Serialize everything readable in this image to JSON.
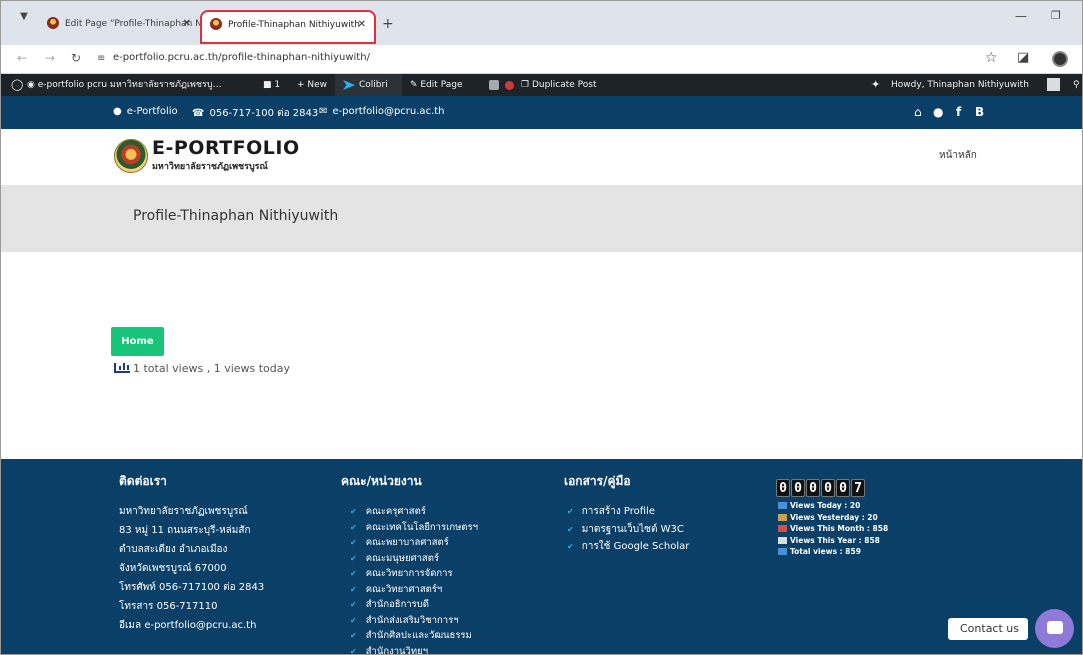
{
  "browser": {
    "tabs": [
      {
        "title": "Edit Page “Profile-Thinaphan N"
      },
      {
        "title": "Profile-Thinaphan Nithiyuwith"
      }
    ],
    "url": "e-portfolio.pcru.ac.th/profile-thinaphan-nithiyuwith/"
  },
  "adminbar": {
    "site": "e-portfolio pcru มหาวิทยาลัยราชภัฏเพชรบู…",
    "comments": "1",
    "new": "New",
    "colibri": "Colibri",
    "edit_page": "Edit Page",
    "duplicate": "Duplicate Post",
    "howdy": "Howdy, Thinaphan Nithiyuwith"
  },
  "topbar": {
    "portfolio": "e-Portfolio",
    "phone": "056-717-100 ต่อ 2843",
    "email": "e-portfolio@pcru.ac.th"
  },
  "header": {
    "logo_title": "E-PORTFOLIO",
    "logo_subtitle": "มหาวิทยาลัยราชภัฏเพชรบูรณ์",
    "nav_home": "หน้าหลัก"
  },
  "page": {
    "title": "Profile-Thinaphan Nithiyuwith",
    "home_button": "Home",
    "views": "1 total views , 1 views today"
  },
  "footer": {
    "contact": {
      "heading": "ติดต่อเรา",
      "lines": [
        "มหาวิทยาลัยราชภัฏเพชรบูรณ์",
        "83 หมู่ 11 ถนนสระบุรี-หล่มสัก",
        "ตำบลสะเดียง อำเภอเมือง",
        "จังหวัดเพชรบูรณ์ 67000",
        "โทรศัพท์ 056-717100 ต่อ 2843",
        "โทรสาร 056-717110",
        "อีเมล e-portfolio@pcru.ac.th"
      ]
    },
    "faculties": {
      "heading": "คณะ/หน่วยงาน",
      "items": [
        "คณะครุศาสตร์",
        "คณะเทคโนโลยีการเกษตรฯ",
        "คณะพยาบาลศาสตร์",
        "คณะมนุษยศาสตร์",
        "คณะวิทยาการจัดการ",
        "คณะวิทยาศาสตร์ฯ",
        "สำนักอธิการบดี",
        "สำนักส่งเสริมวิชาการฯ",
        "สำนักศิลปะและวัฒนธรรม",
        "สำนักงานวิทยฯ"
      ]
    },
    "documents": {
      "heading": "เอกสาร/คู่มือ",
      "items": [
        "การสร้าง Profile",
        "มาตรฐานเว็บไซต์ W3C",
        "การใช้ Google Scholar"
      ]
    },
    "counter_digits": [
      "0",
      "0",
      "0",
      "0",
      "0",
      "7"
    ],
    "stats": [
      {
        "label": "Views Today : 20",
        "icon": "calendar-icon",
        "color": "#4a90d9"
      },
      {
        "label": "Views Yesterday : 20",
        "icon": "person-icon",
        "color": "#c9a24a"
      },
      {
        "label": "Views This Month : 858",
        "icon": "calendar-month-icon",
        "color": "#d94a4a"
      },
      {
        "label": "Views This Year : 858",
        "icon": "calendar-year-icon",
        "color": "#dddddd"
      },
      {
        "label": "Total views : 859",
        "icon": "bar-chart-icon",
        "color": "#4a90d9"
      }
    ],
    "contact_us": "Contact us"
  }
}
